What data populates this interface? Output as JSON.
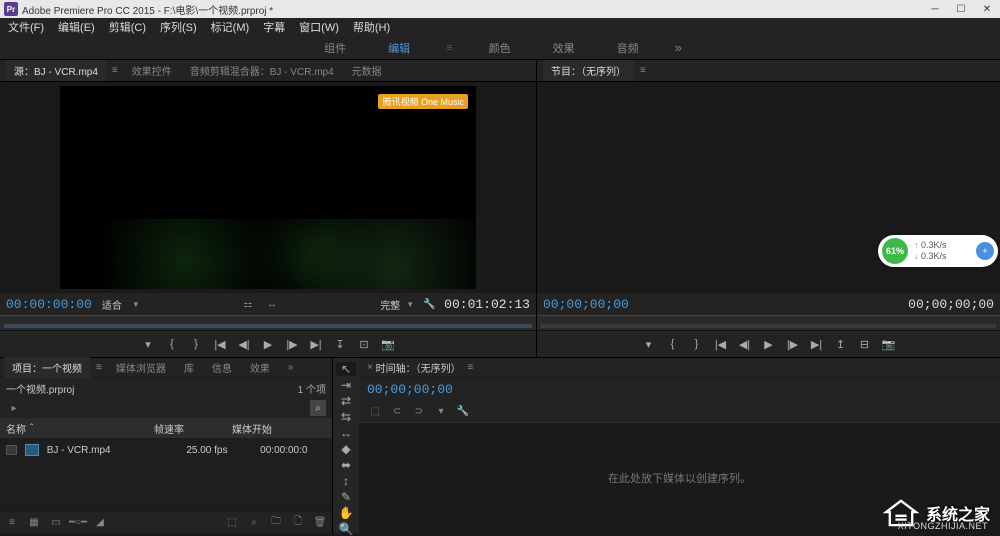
{
  "window": {
    "title": "Adobe Premiere Pro CC 2015 - F:\\电影\\一个视频.prproj *",
    "app_short": "Pr"
  },
  "menu": [
    "文件(F)",
    "编辑(E)",
    "剪辑(C)",
    "序列(S)",
    "标记(M)",
    "字幕",
    "窗口(W)",
    "帮助(H)"
  ],
  "workspaces": {
    "items": [
      "组件",
      "编辑",
      "颜色",
      "效果",
      "音频"
    ],
    "active": 1
  },
  "source_panel": {
    "tabs": [
      "源：BJ - VCR.mp4",
      "效果控件",
      "音频剪辑混合器：BJ - VCR.mp4",
      "元数据"
    ],
    "active": 0,
    "timecode_in": "00:00:00:00",
    "timecode_out": "00:01:02:13",
    "fit_label": "适合",
    "quality_label": "完整",
    "video_watermark": "腾讯视频 One Music"
  },
  "program_panel": {
    "title": "节目：（无序列）",
    "timecode_in": "00;00;00;00",
    "timecode_out": "00;00;00;00"
  },
  "project_panel": {
    "tabs": [
      "项目：一个视频",
      "媒体浏览器",
      "库",
      "信息",
      "效果"
    ],
    "active": 0,
    "project_name": "一个视频.prproj",
    "item_count": "1 个项",
    "columns": {
      "name": "名称",
      "fps": "帧速率",
      "start": "媒体开始"
    },
    "items": [
      {
        "name": "BJ - VCR.mp4",
        "fps": "25.00 fps",
        "start": "00:00:00:0"
      }
    ]
  },
  "timeline_panel": {
    "title": "时间轴：（无序列）",
    "timecode": "00;00;00;00",
    "empty_msg": "在此处放下媒体以创建序列。"
  },
  "net": {
    "percent": "61%",
    "up": "0.3K/s",
    "down": "0.3K/s"
  },
  "footer": {
    "brand": "系统之家",
    "url": "XITONGZHIJIA.NET"
  }
}
